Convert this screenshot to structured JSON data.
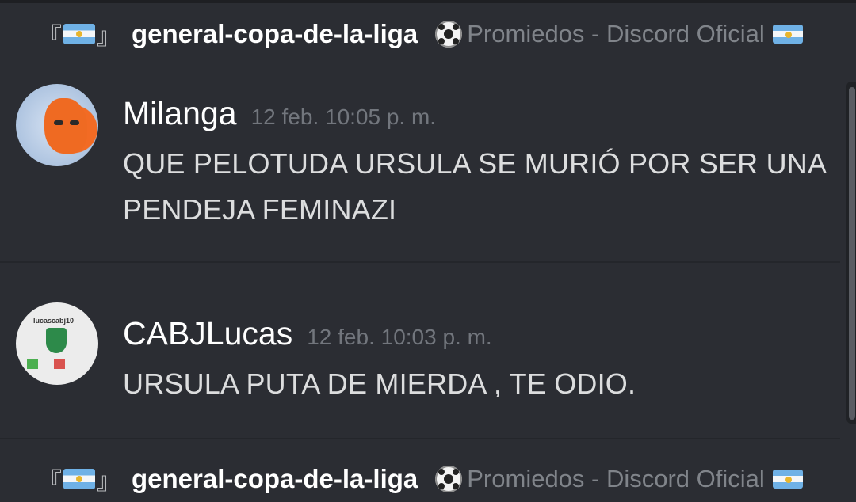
{
  "header": {
    "bracket_open": "『",
    "bracket_close": "』",
    "channel": "general-copa-de-la-liga",
    "server": "Promiedos - Discord Oficial"
  },
  "messages": [
    {
      "username": "Milanga",
      "timestamp": "12 feb. 10:05 p. m.",
      "text": "QUE PELOTUDA URSULA SE MURIÓ POR SER UNA PENDEJA FEMINAZI"
    },
    {
      "username": "CABJLucas",
      "timestamp": "12 feb. 10:03 p. m.",
      "text": "URSULA PUTA DE MIERDA , TE ODIO.",
      "avatar_text": "lucascabj10"
    }
  ],
  "colors": {
    "background": "#2b2d33",
    "username": "#ffffff",
    "timestamp": "#72767d",
    "text": "#dcddde"
  },
  "icons": [
    "argentina-flag-icon",
    "soccer-ball-icon"
  ]
}
